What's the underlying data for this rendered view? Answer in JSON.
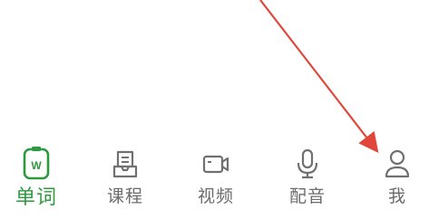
{
  "tabbar": {
    "items": [
      {
        "label": "单词",
        "icon": "word-book-icon",
        "active": true
      },
      {
        "label": "课程",
        "icon": "course-icon",
        "active": false
      },
      {
        "label": "视频",
        "icon": "video-camera-icon",
        "active": false
      },
      {
        "label": "配音",
        "icon": "microphone-icon",
        "active": false
      },
      {
        "label": "我",
        "icon": "user-profile-icon",
        "active": false
      }
    ],
    "active_color": "#2e9a3e",
    "inactive_color": "#6b6b6b"
  },
  "annotation": {
    "arrow_color": "#e0473a",
    "points_to": "我"
  }
}
